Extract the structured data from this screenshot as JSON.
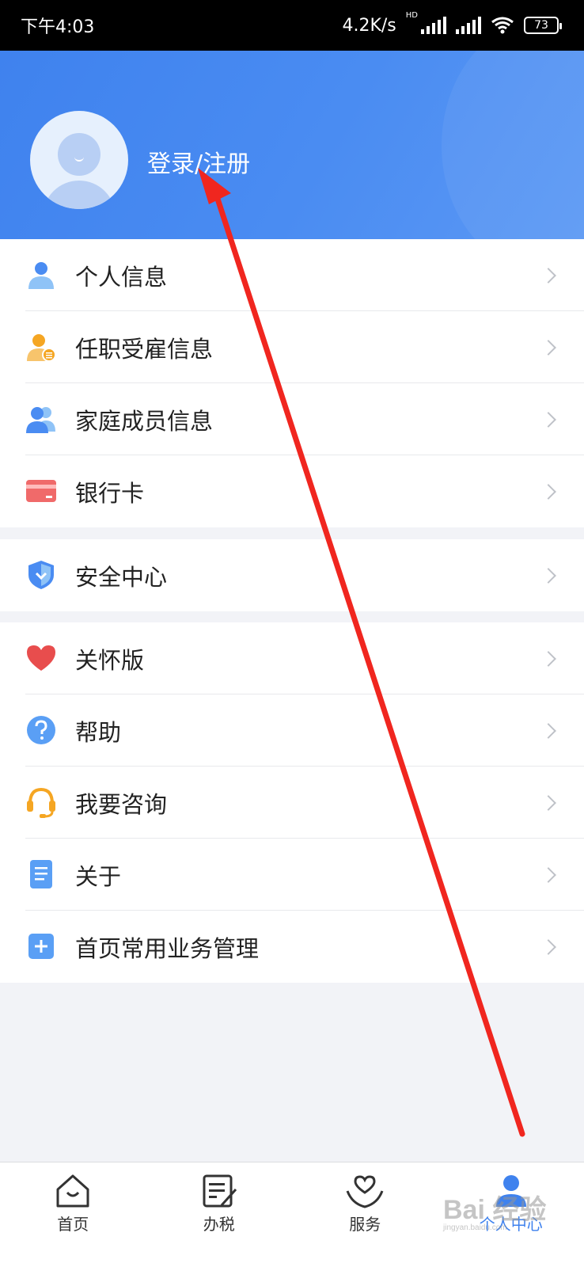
{
  "status_bar": {
    "time": "下午4:03",
    "speed": "4.2K/s",
    "hd": "HD",
    "battery": "73"
  },
  "header": {
    "login_label": "登录/注册",
    "color": "#3f82ee"
  },
  "groups": [
    {
      "items": [
        {
          "label": "个人信息",
          "icon": "person-icon"
        },
        {
          "label": "任职受雇信息",
          "icon": "employment-icon"
        },
        {
          "label": "家庭成员信息",
          "icon": "family-icon"
        },
        {
          "label": "银行卡",
          "icon": "bank-card-icon"
        }
      ]
    },
    {
      "items": [
        {
          "label": "安全中心",
          "icon": "shield-icon"
        }
      ]
    },
    {
      "items": [
        {
          "label": "关怀版",
          "icon": "heart-icon"
        },
        {
          "label": "帮助",
          "icon": "help-icon"
        },
        {
          "label": "我要咨询",
          "icon": "headset-icon"
        },
        {
          "label": "关于",
          "icon": "document-icon"
        },
        {
          "label": "首页常用业务管理",
          "icon": "plus-icon"
        }
      ]
    }
  ],
  "bottom_nav": [
    {
      "label": "首页",
      "icon": "home-icon"
    },
    {
      "label": "办税",
      "icon": "tax-edit-icon"
    },
    {
      "label": "服务",
      "icon": "service-heart-icon"
    },
    {
      "label": "个人中心",
      "icon": "profile-icon",
      "active": true
    }
  ],
  "watermark": {
    "text": "Bai 经验",
    "sub": "jingyan.baidu.com"
  }
}
